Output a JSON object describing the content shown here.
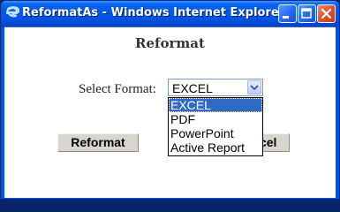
{
  "window": {
    "title": "ReformatAs - Windows Internet Explorer",
    "icon": "ie-icon"
  },
  "page": {
    "heading": "Reformat",
    "select_label": "Select Format:",
    "select": {
      "value": "EXCEL",
      "options": [
        "EXCEL",
        "PDF",
        "PowerPoint",
        "Active Report"
      ],
      "selected_index": 0
    },
    "buttons": {
      "reformat": "Reformat",
      "cancel": "Cancel"
    }
  }
}
